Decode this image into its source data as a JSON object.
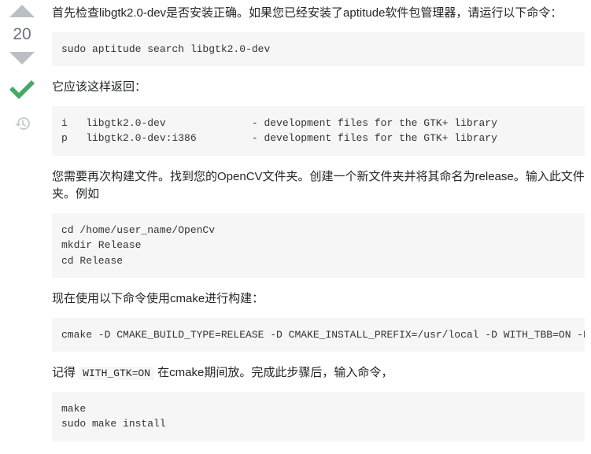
{
  "vote": {
    "score": "20"
  },
  "answer": {
    "p1": "首先检查libgtk2.0-dev是否安装正确。如果您已经安装了aptitude软件包管理器，请运行以下命令：",
    "code1": "sudo aptitude search libgtk2.0-dev",
    "p2": "它应该这样返回：",
    "code2": "i   libgtk2.0-dev              - development files for the GTK+ library\np   libgtk2.0-dev:i386         - development files for the GTK+ library",
    "p3": "您需要再次构建文件。找到您的OpenCV文件夹。创建一个新文件夹并将其命名为release。输入此文件夹。例如",
    "code3": "cd /home/user_name/OpenCv\nmkdir Release\ncd Release",
    "p4": "现在使用以下命令使用cmake进行构建：",
    "code4": "cmake -D CMAKE_BUILD_TYPE=RELEASE -D CMAKE_INSTALL_PREFIX=/usr/local -D WITH_TBB=ON -D BUILD_NEW_PYTHON_SUPPORT=ON -D WITH_V4L=ON -D INSTALL_C_EXAMPLES=ON -D INSTALL_PYTHON_EXAMPLES=ON -D BUILD_EXAMPLES=ON -D WITH_QT=ON -D WITH_GTK=ON -D WITH_OPENGL=ON ..",
    "p5a": "记得 ",
    "inline1": "WITH_GTK=ON",
    "p5b": " 在cmake期间放。完成此步骤后，输入命令，",
    "code5": "make\nsudo make install"
  }
}
